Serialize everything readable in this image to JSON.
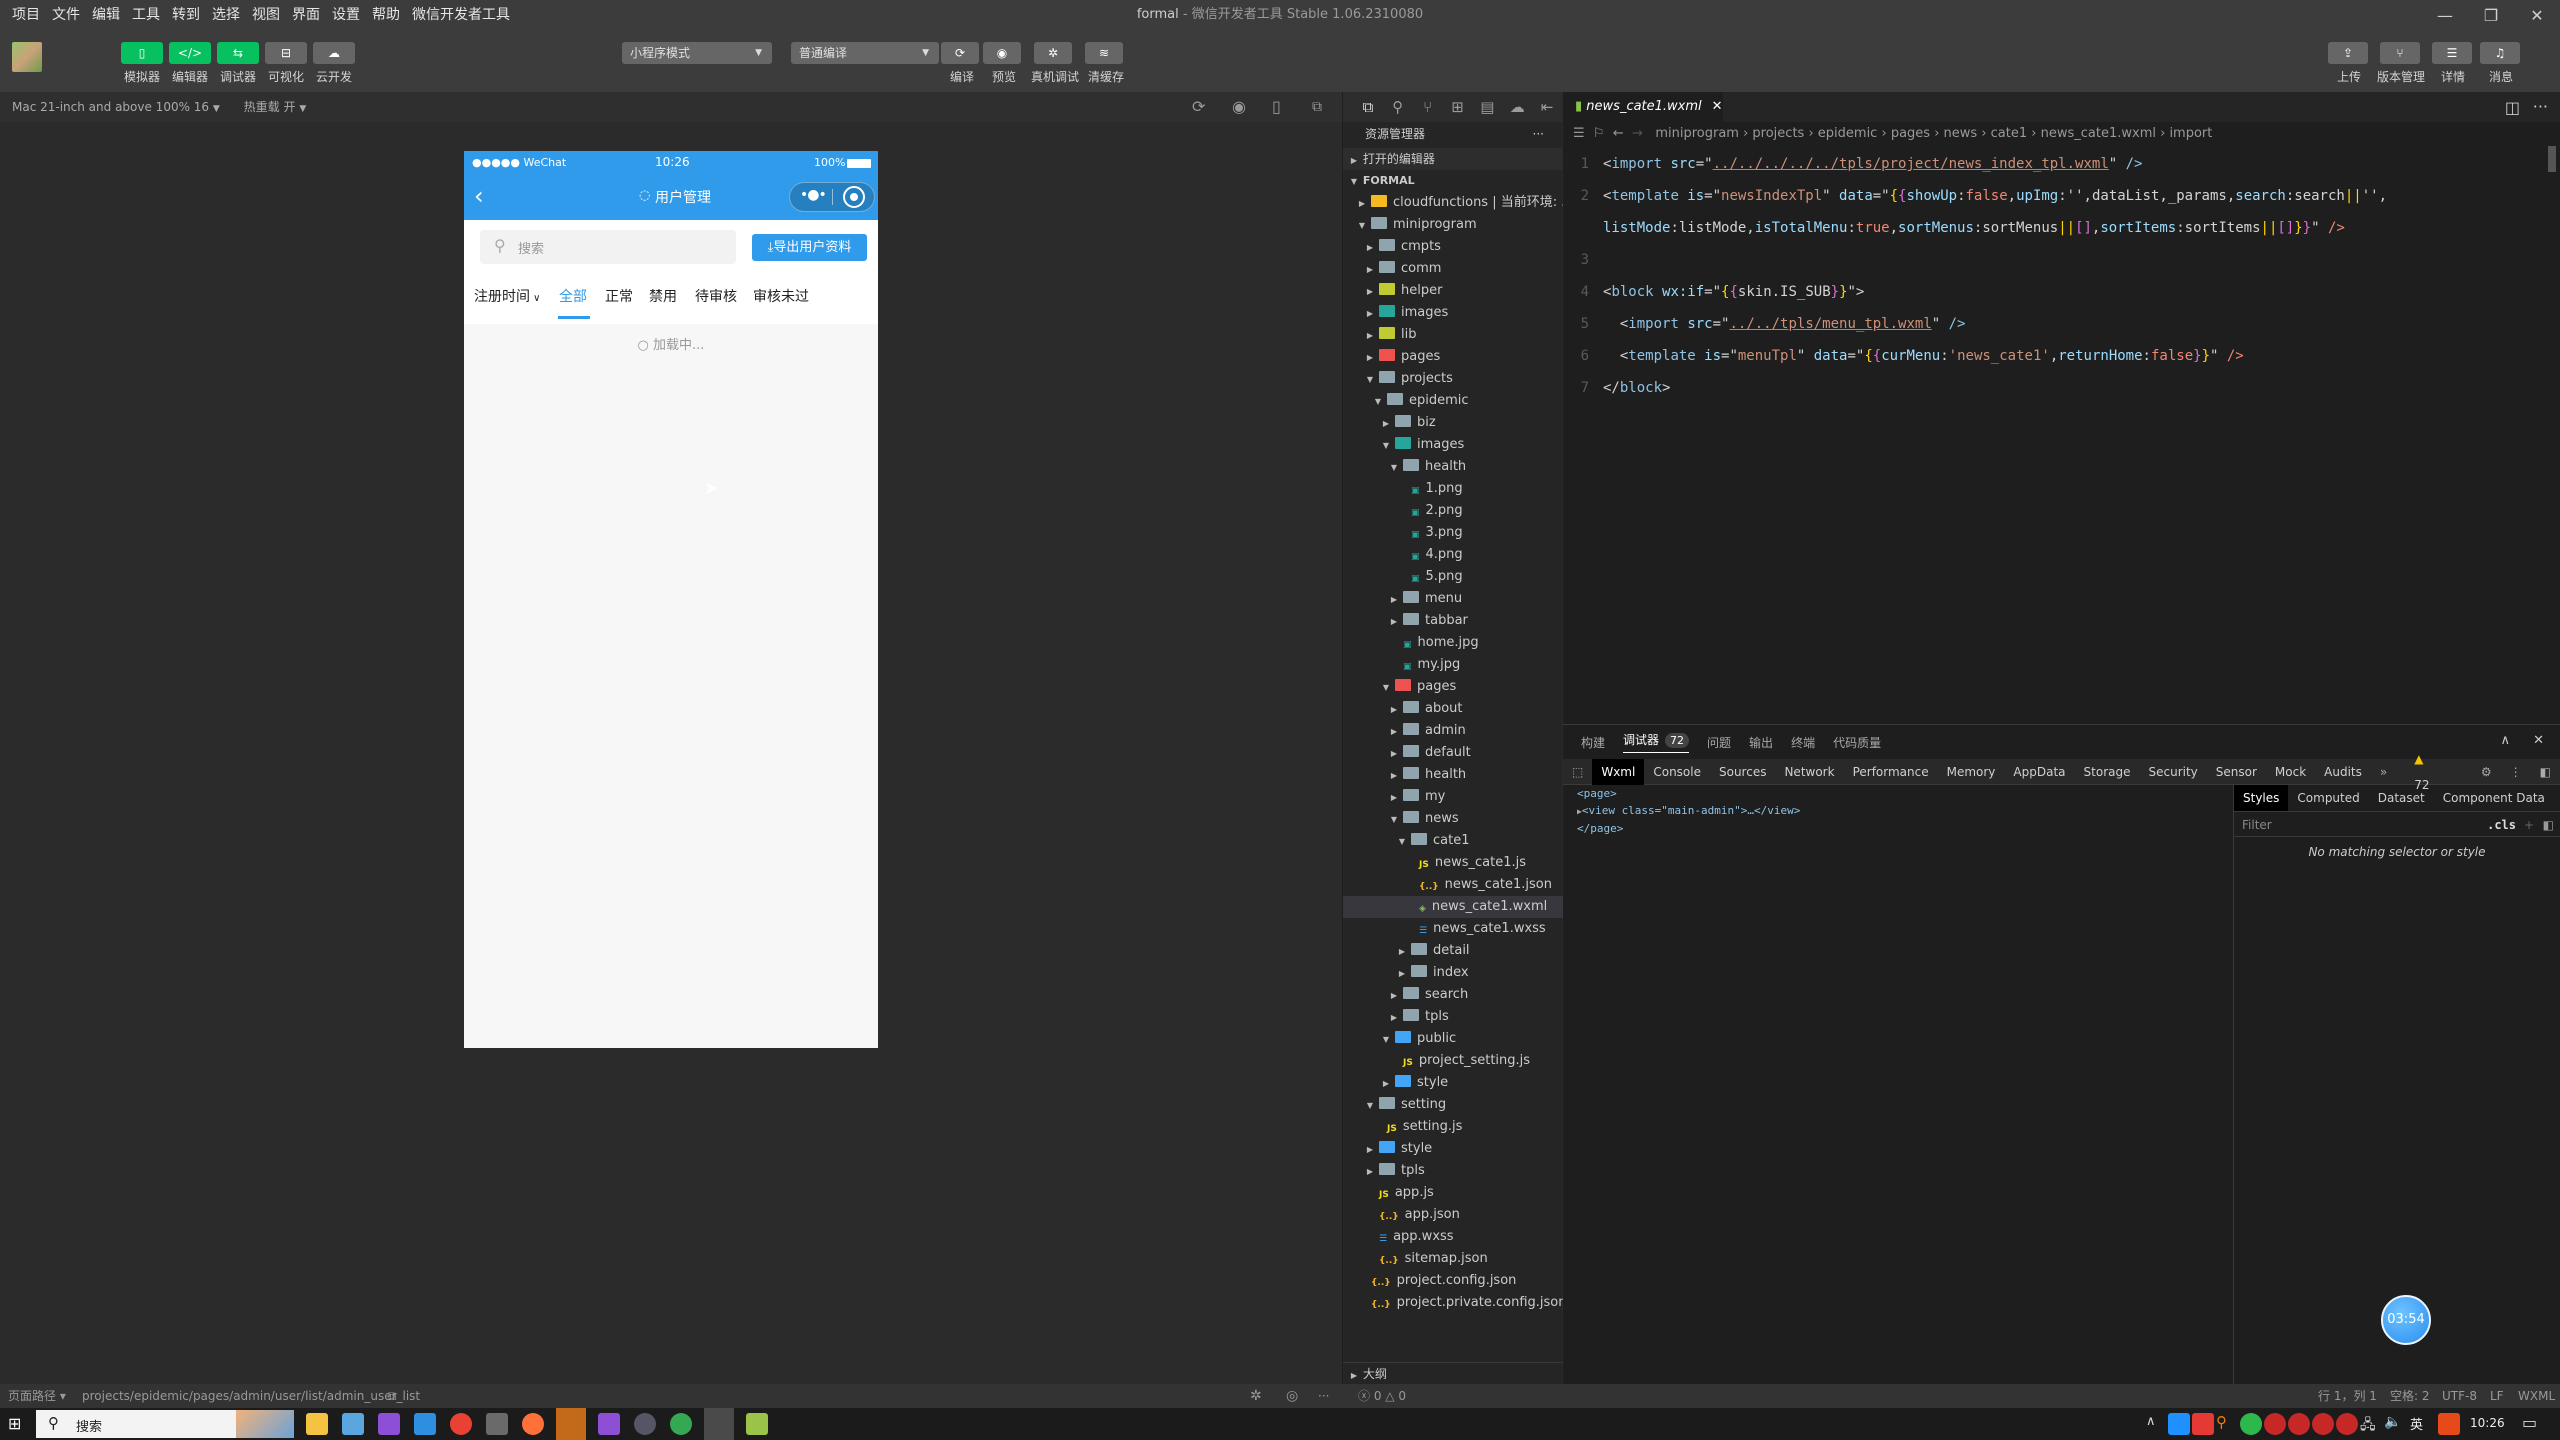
{
  "window": {
    "project": "formal",
    "app_title": "微信开发者工具 Stable 1.06.2310080"
  },
  "menu": [
    "项目",
    "文件",
    "编辑",
    "工具",
    "转到",
    "选择",
    "视图",
    "界面",
    "设置",
    "帮助",
    "微信开发者工具"
  ],
  "toolbar": {
    "left_buttons": [
      {
        "label": "模拟器",
        "icon": "phone-icon",
        "active": true
      },
      {
        "label": "编辑器",
        "icon": "code-icon",
        "active": true
      },
      {
        "label": "调试器",
        "icon": "sliders-icon",
        "active": true
      },
      {
        "label": "可视化",
        "icon": "layout-icon",
        "active": false
      },
      {
        "label": "云开发",
        "icon": "cloud-icon",
        "active": false
      }
    ],
    "mode_select": "小程序模式",
    "compile_select": "普通编译",
    "mid_buttons": [
      {
        "label": "编译",
        "icon": "refresh-icon"
      },
      {
        "label": "预览",
        "icon": "eye-icon"
      },
      {
        "label": "真机调试",
        "icon": "bug-icon"
      },
      {
        "label": "清缓存",
        "icon": "layers-icon"
      }
    ],
    "right_buttons": [
      {
        "label": "上传",
        "icon": "upload-icon"
      },
      {
        "label": "版本管理",
        "icon": "branch-icon"
      },
      {
        "label": "详情",
        "icon": "menu-icon"
      },
      {
        "label": "消息",
        "icon": "bell-icon"
      }
    ]
  },
  "device_bar": {
    "device": "Mac 21-inch and above 100% 16",
    "hot_reload": "热重载 开"
  },
  "phone": {
    "status_left": "●●●●● WeChat",
    "status_time": "10:26",
    "status_battery": "100%",
    "nav_title": "用户管理",
    "search_placeholder": "搜索",
    "export_button": "导出用户资料",
    "sort_label": "注册时间",
    "tabs": [
      {
        "label": "全部",
        "active": true
      },
      {
        "label": "正常",
        "active": false
      },
      {
        "label": "禁用",
        "active": false
      },
      {
        "label": "待审核",
        "active": false
      },
      {
        "label": "审核未过",
        "active": false
      }
    ],
    "loading_text": "加载中...",
    "accent": "#2f9bea"
  },
  "explorer": {
    "title": "资源管理器",
    "open_editors": "打开的编辑器",
    "root": "FORMAL",
    "outline": "大纲",
    "tree": [
      {
        "label": "cloudfunctions | 当前环境: ...",
        "depth": 1,
        "type": "folder",
        "color": "#f5b921",
        "open": false
      },
      {
        "label": "miniprogram",
        "depth": 1,
        "type": "folder",
        "color": "#90a4ae",
        "open": true
      },
      {
        "label": "cmpts",
        "depth": 2,
        "type": "folder",
        "color": "#90a4ae",
        "open": false
      },
      {
        "label": "comm",
        "depth": 2,
        "type": "folder",
        "color": "#90a4ae",
        "open": false
      },
      {
        "label": "helper",
        "depth": 2,
        "type": "folder",
        "color": "#c0ca33",
        "open": false
      },
      {
        "label": "images",
        "depth": 2,
        "type": "folder",
        "color": "#26a69a",
        "open": false
      },
      {
        "label": "lib",
        "depth": 2,
        "type": "folder",
        "color": "#c0ca33",
        "open": false
      },
      {
        "label": "pages",
        "depth": 2,
        "type": "folder",
        "color": "#ef5350",
        "open": false
      },
      {
        "label": "projects",
        "depth": 2,
        "type": "folder",
        "color": "#90a4ae",
        "open": true
      },
      {
        "label": "epidemic",
        "depth": 3,
        "type": "folder",
        "color": "#90a4ae",
        "open": true
      },
      {
        "label": "biz",
        "depth": 4,
        "type": "folder",
        "color": "#90a4ae",
        "open": false
      },
      {
        "label": "images",
        "depth": 4,
        "type": "folder",
        "color": "#26a69a",
        "open": true
      },
      {
        "label": "health",
        "depth": 5,
        "type": "folder",
        "color": "#90a4ae",
        "open": true
      },
      {
        "label": "1.png",
        "depth": 6,
        "type": "image",
        "color": "#26a69a"
      },
      {
        "label": "2.png",
        "depth": 6,
        "type": "image",
        "color": "#26a69a"
      },
      {
        "label": "3.png",
        "depth": 6,
        "type": "image",
        "color": "#26a69a"
      },
      {
        "label": "4.png",
        "depth": 6,
        "type": "image",
        "color": "#26a69a"
      },
      {
        "label": "5.png",
        "depth": 6,
        "type": "image",
        "color": "#26a69a"
      },
      {
        "label": "menu",
        "depth": 5,
        "type": "folder",
        "color": "#90a4ae",
        "open": false
      },
      {
        "label": "tabbar",
        "depth": 5,
        "type": "folder",
        "color": "#90a4ae",
        "open": false
      },
      {
        "label": "home.jpg",
        "depth": 5,
        "type": "image",
        "color": "#26a69a"
      },
      {
        "label": "my.jpg",
        "depth": 5,
        "type": "image",
        "color": "#26a69a"
      },
      {
        "label": "pages",
        "depth": 4,
        "type": "folder",
        "color": "#ef5350",
        "open": true
      },
      {
        "label": "about",
        "depth": 5,
        "type": "folder",
        "color": "#90a4ae",
        "open": false
      },
      {
        "label": "admin",
        "depth": 5,
        "type": "folder",
        "color": "#90a4ae",
        "open": false
      },
      {
        "label": "default",
        "depth": 5,
        "type": "folder",
        "color": "#90a4ae",
        "open": false
      },
      {
        "label": "health",
        "depth": 5,
        "type": "folder",
        "color": "#90a4ae",
        "open": false
      },
      {
        "label": "my",
        "depth": 5,
        "type": "folder",
        "color": "#90a4ae",
        "open": false
      },
      {
        "label": "news",
        "depth": 5,
        "type": "folder",
        "color": "#90a4ae",
        "open": true
      },
      {
        "label": "cate1",
        "depth": 6,
        "type": "folder",
        "color": "#90a4ae",
        "open": true
      },
      {
        "label": "news_cate1.js",
        "depth": 7,
        "type": "js",
        "color": "#f5de19"
      },
      {
        "label": "news_cate1.json",
        "depth": 7,
        "type": "json",
        "color": "#f5b921"
      },
      {
        "label": "news_cate1.wxml",
        "depth": 7,
        "type": "wxml",
        "color": "#8bc34a",
        "selected": true
      },
      {
        "label": "news_cate1.wxss",
        "depth": 7,
        "type": "css",
        "color": "#42a5f5"
      },
      {
        "label": "detail",
        "depth": 6,
        "type": "folder",
        "color": "#90a4ae",
        "open": false
      },
      {
        "label": "index",
        "depth": 6,
        "type": "folder",
        "color": "#90a4ae",
        "open": false
      },
      {
        "label": "search",
        "depth": 5,
        "type": "folder",
        "color": "#90a4ae",
        "open": false
      },
      {
        "label": "tpls",
        "depth": 5,
        "type": "folder",
        "color": "#90a4ae",
        "open": false
      },
      {
        "label": "public",
        "depth": 4,
        "type": "folder",
        "color": "#42a5f5",
        "open": true
      },
      {
        "label": "project_setting.js",
        "depth": 5,
        "type": "js",
        "color": "#f5de19"
      },
      {
        "label": "style",
        "depth": 4,
        "type": "folder",
        "color": "#42a5f5",
        "open": false
      },
      {
        "label": "setting",
        "depth": 2,
        "type": "folder",
        "color": "#90a4ae",
        "open": true
      },
      {
        "label": "setting.js",
        "depth": 3,
        "type": "js",
        "color": "#f5de19"
      },
      {
        "label": "style",
        "depth": 2,
        "type": "folder",
        "color": "#42a5f5",
        "open": false
      },
      {
        "label": "tpls",
        "depth": 2,
        "type": "folder",
        "color": "#90a4ae",
        "open": false
      },
      {
        "label": "app.js",
        "depth": 2,
        "type": "js",
        "color": "#f5de19"
      },
      {
        "label": "app.json",
        "depth": 2,
        "type": "json",
        "color": "#f5b921"
      },
      {
        "label": "app.wxss",
        "depth": 2,
        "type": "css",
        "color": "#42a5f5"
      },
      {
        "label": "sitemap.json",
        "depth": 2,
        "type": "json",
        "color": "#f5b921"
      },
      {
        "label": "project.config.json",
        "depth": 1,
        "type": "json",
        "color": "#f5b921"
      },
      {
        "label": "project.private.config.json",
        "depth": 1,
        "type": "json",
        "color": "#f5b921"
      }
    ]
  },
  "editor": {
    "tab": "news_cate1.wxml",
    "breadcrumb": [
      "miniprogram",
      "projects",
      "epidemic",
      "pages",
      "news",
      "cate1",
      "news_cate1.wxml",
      "import"
    ],
    "lines": [
      {
        "n": "1",
        "tokens": [
          [
            "c-punc",
            "<"
          ],
          [
            "c-tag",
            "import "
          ],
          [
            "c-attr",
            "src"
          ],
          [
            "c-punc",
            "=\""
          ],
          [
            "c-str ul",
            "../../../../../tpls/project/news_index_tpl.wxml"
          ],
          [
            "c-punc",
            "\" "
          ],
          [
            "c-tag",
            "/>"
          ]
        ]
      },
      {
        "n": "2",
        "tokens": [
          [
            "c-punc",
            "<"
          ],
          [
            "c-tag",
            "template "
          ],
          [
            "c-attr",
            "is"
          ],
          [
            "c-punc",
            "=\""
          ],
          [
            "c-str",
            "newsIndexTpl"
          ],
          [
            "c-punc",
            "\" "
          ],
          [
            "c-attr",
            "data"
          ],
          [
            "c-punc",
            "=\""
          ],
          [
            "c-br1",
            "{"
          ],
          [
            "c-br2",
            "{"
          ],
          [
            "c-var",
            "showUp"
          ],
          [
            "c-punc",
            ":"
          ],
          [
            "c-kw",
            "false"
          ],
          [
            "c-punc",
            ","
          ],
          [
            "c-var",
            "upImg"
          ],
          [
            "c-punc",
            ":'',dataList,_params,"
          ],
          [
            "c-var",
            "search"
          ],
          [
            "c-punc",
            ":search"
          ],
          [
            "c-br1",
            "||"
          ],
          [
            "c-punc",
            "'',"
          ]
        ]
      },
      {
        "n": "",
        "tokens": [
          [
            "c-var",
            "listMode"
          ],
          [
            "c-punc",
            ":listMode,"
          ],
          [
            "c-var",
            "isTotalMenu"
          ],
          [
            "c-punc",
            ":"
          ],
          [
            "c-kw",
            "true"
          ],
          [
            "c-punc",
            ","
          ],
          [
            "c-var",
            "sortMenus"
          ],
          [
            "c-punc",
            ":sortMenus"
          ],
          [
            "c-br1",
            "||"
          ],
          [
            "c-br2",
            "[]"
          ],
          [
            "c-punc",
            ","
          ],
          [
            "c-var",
            "sortItems"
          ],
          [
            "c-punc",
            ":sortItems"
          ],
          [
            "c-br1",
            "||"
          ],
          [
            "c-br2",
            "[]"
          ],
          [
            "c-br1",
            "}"
          ],
          [
            "c-br2",
            "}"
          ],
          [
            "c-punc",
            "\" "
          ],
          [
            "c-kw",
            "/>"
          ]
        ]
      },
      {
        "n": "3",
        "tokens": []
      },
      {
        "n": "4",
        "tokens": [
          [
            "c-punc",
            "<"
          ],
          [
            "c-tag",
            "block "
          ],
          [
            "c-attr",
            "wx:if"
          ],
          [
            "c-punc",
            "=\""
          ],
          [
            "c-br1",
            "{"
          ],
          [
            "c-br2",
            "{"
          ],
          [
            "c-punc",
            "skin.IS_SUB"
          ],
          [
            "c-br2",
            "}"
          ],
          [
            "c-br1",
            "}"
          ],
          [
            "c-punc",
            "\">"
          ]
        ]
      },
      {
        "n": "5",
        "tokens": [
          [
            "c-punc",
            "  <"
          ],
          [
            "c-tag",
            "import "
          ],
          [
            "c-attr",
            "src"
          ],
          [
            "c-punc",
            "=\""
          ],
          [
            "c-str ul",
            "../../tpls/menu_tpl.wxml"
          ],
          [
            "c-punc",
            "\" "
          ],
          [
            "c-tag",
            "/>"
          ]
        ]
      },
      {
        "n": "6",
        "tokens": [
          [
            "c-punc",
            "  <"
          ],
          [
            "c-tag",
            "template "
          ],
          [
            "c-attr",
            "is"
          ],
          [
            "c-punc",
            "=\""
          ],
          [
            "c-str",
            "menuTpl"
          ],
          [
            "c-punc",
            "\" "
          ],
          [
            "c-attr",
            "data"
          ],
          [
            "c-punc",
            "=\""
          ],
          [
            "c-br1",
            "{"
          ],
          [
            "c-br2",
            "{"
          ],
          [
            "c-var",
            "curMenu"
          ],
          [
            "c-punc",
            ":"
          ],
          [
            "c-str",
            "'news_cate1'"
          ],
          [
            "c-punc",
            ","
          ],
          [
            "c-var",
            "returnHome"
          ],
          [
            "c-punc",
            ":"
          ],
          [
            "c-kw",
            "false"
          ],
          [
            "c-br2",
            "}"
          ],
          [
            "c-br1",
            "}"
          ],
          [
            "c-punc",
            "\" "
          ],
          [
            "c-kw",
            "/>"
          ]
        ]
      },
      {
        "n": "7",
        "tokens": [
          [
            "c-punc",
            "</"
          ],
          [
            "c-tag",
            "block"
          ],
          [
            "c-punc",
            ">"
          ]
        ]
      }
    ]
  },
  "debugger": {
    "tabs": [
      "构建",
      "调试器",
      "问题",
      "输出",
      "终端",
      "代码质量"
    ],
    "badge": "72",
    "devtools_tabs": [
      "Wxml",
      "Console",
      "Sources",
      "Network",
      "Performance",
      "Memory",
      "AppData",
      "Storage",
      "Security",
      "Sensor",
      "Mock",
      "Audits"
    ],
    "warnings": "72",
    "wxml": [
      "<page>",
      "<view class=\"main-admin\">…</view>",
      "</page>"
    ],
    "style_tabs": [
      "Styles",
      "Computed",
      "Dataset",
      "Component Data"
    ],
    "filter_placeholder": "Filter",
    "cls": ".cls",
    "no_match": "No matching selector or style"
  },
  "timer": "03:54",
  "statusbar": {
    "page_path_label": "页面路径",
    "page_path": "projects/epidemic/pages/admin/user/list/admin_user_list",
    "problems": "0",
    "warnings": "0",
    "cursor": "行 1，列 1",
    "spaces": "空格: 2",
    "encoding": "UTF-8",
    "eol": "LF",
    "language": "WXML"
  },
  "taskbar": {
    "search": "搜索",
    "ime": "英",
    "time": "10:26"
  }
}
